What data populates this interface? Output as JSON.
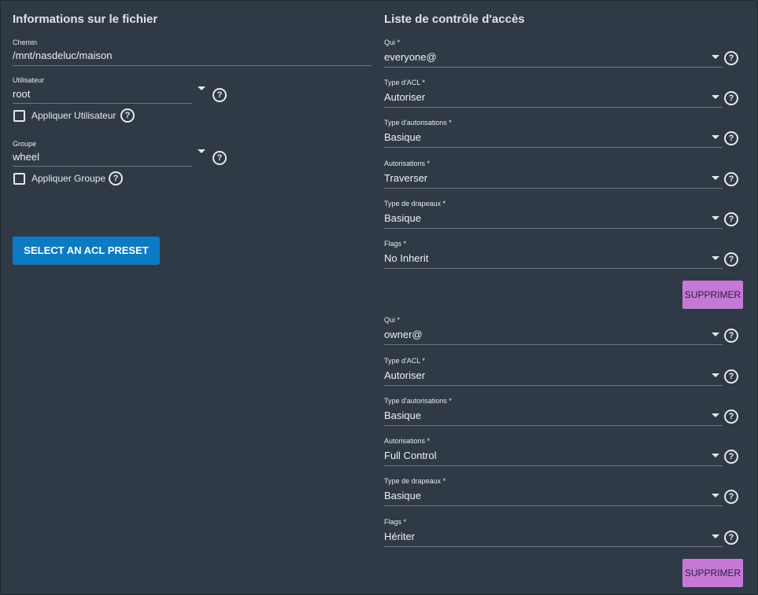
{
  "file_info": {
    "title": "Informations sur le fichier",
    "path_label": "Chemin",
    "path_value": "/mnt/nasdeluc/maison",
    "user_label": "Utilisateur",
    "user_value": "root",
    "apply_user_label": "Appliquer Utilisateur",
    "group_label": "Groupe",
    "group_value": "wheel",
    "apply_group_label": "Appliquer Groupe",
    "preset_button": "SELECT AN ACL PRESET"
  },
  "acl": {
    "title": "Liste de contrôle d'accès",
    "help_glyph": "?",
    "delete_label": "SUPPRIMER",
    "entries": [
      {
        "who_label": "Qui *",
        "who": "everyone@",
        "acl_type_label": "Type d'ACL *",
        "acl_type": "Autoriser",
        "perm_type_label": "Type d'autorisations *",
        "perm_type": "Basique",
        "perms_label": "Autorisations *",
        "perms": "Traverser",
        "flags_type_label": "Type de drapeaux *",
        "flags_type": "Basique",
        "flags_label": "Flags *",
        "flags": "No Inherit"
      },
      {
        "who_label": "Qui *",
        "who": "owner@",
        "acl_type_label": "Type d'ACL *",
        "acl_type": "Autoriser",
        "perm_type_label": "Type d'autorisations *",
        "perm_type": "Basique",
        "perms_label": "Autorisations *",
        "perms": "Full Control",
        "flags_type_label": "Type de drapeaux *",
        "flags_type": "Basique",
        "flags_label": "Flags *",
        "flags": "Hériter"
      }
    ]
  },
  "colors": {
    "background": "#2f3a46",
    "primary_button": "#0d7ac4",
    "delete_button": "#c678d6"
  },
  "icons": [
    "help-circle-icon",
    "dropdown-caret-icon",
    "checkbox-icon"
  ]
}
